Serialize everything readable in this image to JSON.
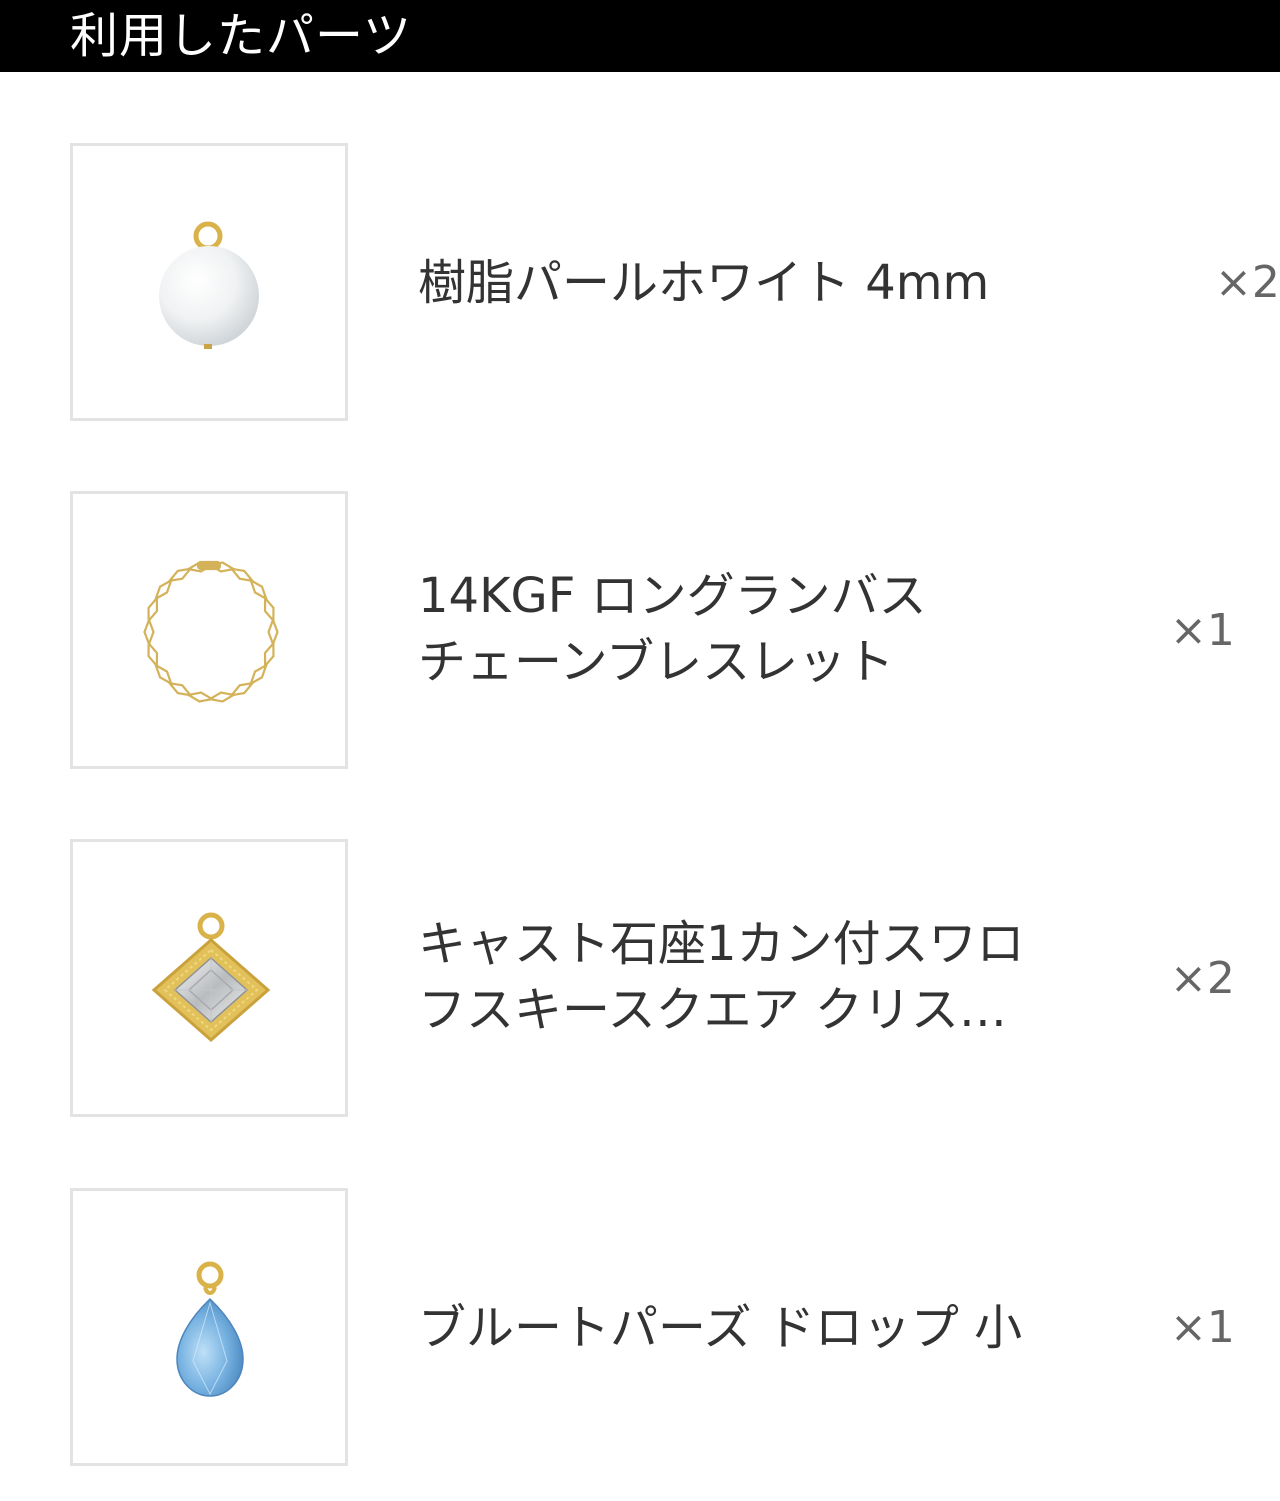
{
  "header": {
    "title": "利用したパーツ"
  },
  "parts": [
    {
      "icon": "pearl-charm-icon",
      "name_lines": [
        "樹脂パールホワイト 4mm"
      ],
      "qty": "×2"
    },
    {
      "icon": "chain-bracelet-icon",
      "name_lines": [
        "14KGF ロングランバス",
        "チェーンブレスレット"
      ],
      "qty": "×1"
    },
    {
      "icon": "square-crystal-charm-icon",
      "name_lines": [
        "キャスト石座1カン付スワロ",
        "フスキースクエア クリス…"
      ],
      "qty": "×2"
    },
    {
      "icon": "blue-topaz-drop-icon",
      "name_lines": [
        "ブルートパーズ ドロップ 小"
      ],
      "qty": "×1"
    }
  ],
  "colors": {
    "header_bg": "#000000",
    "header_text": "#ffffff",
    "thumb_border": "#e3e3e3",
    "gold": "#d9b24a",
    "topaz": "#6fa9dc"
  }
}
